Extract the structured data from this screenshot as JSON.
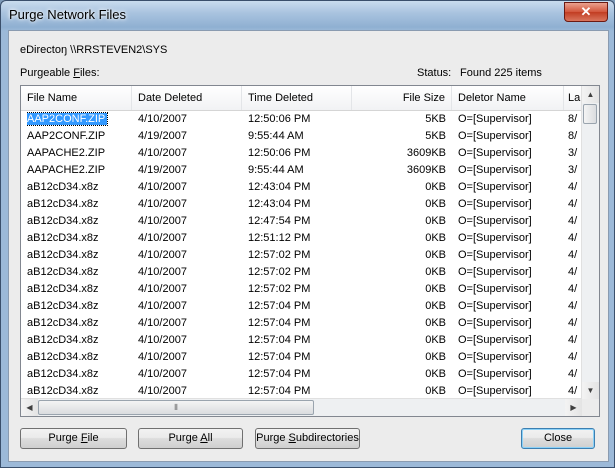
{
  "window": {
    "title": "Purge Network Files",
    "close_glyph": "✕"
  },
  "path_label": "eDirectoŋ \\\\RRSTEVEN2\\SYS",
  "purgeable_label": "Purgeable Files:",
  "status": {
    "label": "Status:",
    "value": "Found 225 items"
  },
  "columns": [
    "File Name",
    "Date Deleted",
    "Time Deleted",
    "File Size",
    "Deletor Name",
    "La"
  ],
  "rows": [
    [
      "AAP2CONF.ZIP",
      "4/10/2007",
      "12:50:06 PM",
      "5KB",
      "O=[Supervisor]",
      "8/"
    ],
    [
      "AAP2CONF.ZIP",
      "4/19/2007",
      "9:55:44 AM",
      "5KB",
      "O=[Supervisor]",
      "8/"
    ],
    [
      "AAPACHE2.ZIP",
      "4/10/2007",
      "12:50:06 PM",
      "3609KB",
      "O=[Supervisor]",
      "3/"
    ],
    [
      "AAPACHE2.ZIP",
      "4/19/2007",
      "9:55:44 AM",
      "3609KB",
      "O=[Supervisor]",
      "3/"
    ],
    [
      "aB12cD34.x8z",
      "4/10/2007",
      "12:43:04 PM",
      "0KB",
      "O=[Supervisor]",
      "4/"
    ],
    [
      "aB12cD34.x8z",
      "4/10/2007",
      "12:43:04 PM",
      "0KB",
      "O=[Supervisor]",
      "4/"
    ],
    [
      "aB12cD34.x8z",
      "4/10/2007",
      "12:47:54 PM",
      "0KB",
      "O=[Supervisor]",
      "4/"
    ],
    [
      "aB12cD34.x8z",
      "4/10/2007",
      "12:51:12 PM",
      "0KB",
      "O=[Supervisor]",
      "4/"
    ],
    [
      "aB12cD34.x8z",
      "4/10/2007",
      "12:57:02 PM",
      "0KB",
      "O=[Supervisor]",
      "4/"
    ],
    [
      "aB12cD34.x8z",
      "4/10/2007",
      "12:57:02 PM",
      "0KB",
      "O=[Supervisor]",
      "4/"
    ],
    [
      "aB12cD34.x8z",
      "4/10/2007",
      "12:57:02 PM",
      "0KB",
      "O=[Supervisor]",
      "4/"
    ],
    [
      "aB12cD34.x8z",
      "4/10/2007",
      "12:57:04 PM",
      "0KB",
      "O=[Supervisor]",
      "4/"
    ],
    [
      "aB12cD34.x8z",
      "4/10/2007",
      "12:57:04 PM",
      "0KB",
      "O=[Supervisor]",
      "4/"
    ],
    [
      "aB12cD34.x8z",
      "4/10/2007",
      "12:57:04 PM",
      "0KB",
      "O=[Supervisor]",
      "4/"
    ],
    [
      "aB12cD34.x8z",
      "4/10/2007",
      "12:57:04 PM",
      "0KB",
      "O=[Supervisor]",
      "4/"
    ],
    [
      "aB12cD34.x8z",
      "4/10/2007",
      "12:57:04 PM",
      "0KB",
      "O=[Supervisor]",
      "4/"
    ],
    [
      "aB12cD34.x8z",
      "4/10/2007",
      "12:57:04 PM",
      "0KB",
      "O=[Supervisor]",
      "4/"
    ]
  ],
  "selected_row": 0,
  "scroll_glyphs": {
    "up": "▲",
    "down": "▼",
    "left": "◀",
    "right": "▶",
    "grip": "⦀"
  },
  "buttons": {
    "purge_file": {
      "label": "Purge File",
      "accel": "F"
    },
    "purge_all": {
      "label": "Purge All",
      "accel": "A"
    },
    "purge_subdirs": {
      "label": "Purge Subdirectories",
      "accel": "S"
    },
    "close": {
      "label": "Close"
    }
  },
  "colors": {
    "selection": "#3399ff",
    "close_button": "#c23d22"
  }
}
